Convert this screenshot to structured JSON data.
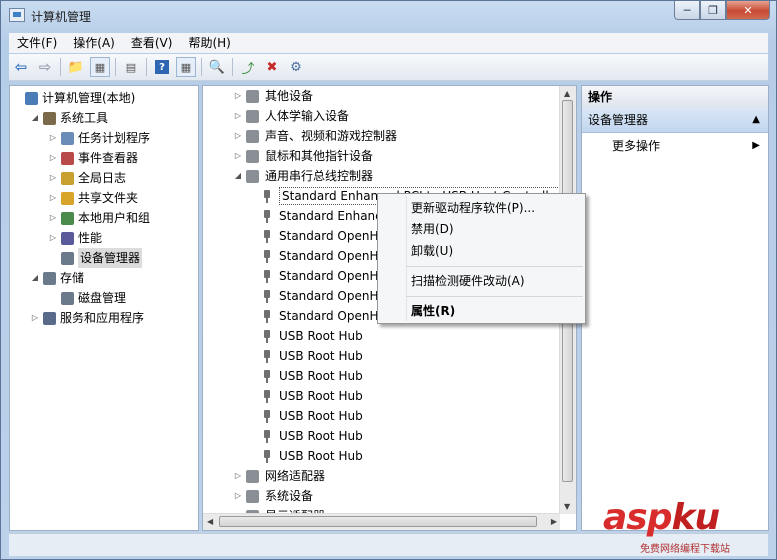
{
  "window": {
    "title": "计算机管理"
  },
  "caption": {
    "minimize": "▭",
    "restore": "▢",
    "close": "✕"
  },
  "menu": [
    "文件(F)",
    "操作(A)",
    "查看(V)",
    "帮助(H)"
  ],
  "left_tree": [
    {
      "label": "计算机管理(本地)",
      "icon": "computer-management-icon",
      "twisty": ""
    },
    {
      "label": "系统工具",
      "icon": "tools-icon",
      "twisty": "◢"
    },
    {
      "label": "任务计划程序",
      "icon": "clock-icon",
      "twisty": "▷"
    },
    {
      "label": "事件查看器",
      "icon": "event-viewer-icon",
      "twisty": "▷"
    },
    {
      "label": "全局日志",
      "icon": "log-icon",
      "twisty": "▷"
    },
    {
      "label": "共享文件夹",
      "icon": "shared-folder-icon",
      "twisty": "▷"
    },
    {
      "label": "本地用户和组",
      "icon": "users-icon",
      "twisty": "▷"
    },
    {
      "label": "性能",
      "icon": "performance-icon",
      "twisty": "▷"
    },
    {
      "label": "设备管理器",
      "icon": "device-manager-icon",
      "twisty": ""
    },
    {
      "label": "存储",
      "icon": "storage-icon",
      "twisty": "◢"
    },
    {
      "label": "磁盘管理",
      "icon": "disk-icon",
      "twisty": ""
    },
    {
      "label": "服务和应用程序",
      "icon": "services-icon",
      "twisty": "▷"
    }
  ],
  "device_tree": [
    {
      "label": "其他设备",
      "twisty": "▷",
      "icon": "other-devices-icon"
    },
    {
      "label": "人体学输入设备",
      "twisty": "▷",
      "icon": "hid-icon"
    },
    {
      "label": "声音、视频和游戏控制器",
      "twisty": "▷",
      "icon": "sound-icon"
    },
    {
      "label": "鼠标和其他指针设备",
      "twisty": "▷",
      "icon": "mouse-icon"
    },
    {
      "label": "通用串行总线控制器",
      "twisty": "◢",
      "icon": "usb-controller-icon"
    },
    {
      "label": "Standard Enhanced PCI to USB Host Controller",
      "twisty": "",
      "icon": "usb"
    },
    {
      "label": "Standard Enhanced PCI to USB Host Controller",
      "twisty": "",
      "icon": "usb"
    },
    {
      "label": "Standard OpenHCD USB Host Controller",
      "twisty": "",
      "icon": "usb"
    },
    {
      "label": "Standard OpenHCD USB Host Controller",
      "twisty": "",
      "icon": "usb"
    },
    {
      "label": "Standard OpenHCD USB Host Controller",
      "twisty": "",
      "icon": "usb"
    },
    {
      "label": "Standard OpenHCD USB Host Controller",
      "twisty": "",
      "icon": "usb"
    },
    {
      "label": "Standard OpenHCD USB Host Controller",
      "twisty": "",
      "icon": "usb"
    },
    {
      "label": "USB Root Hub",
      "twisty": "",
      "icon": "usb"
    },
    {
      "label": "USB Root Hub",
      "twisty": "",
      "icon": "usb"
    },
    {
      "label": "USB Root Hub",
      "twisty": "",
      "icon": "usb"
    },
    {
      "label": "USB Root Hub",
      "twisty": "",
      "icon": "usb"
    },
    {
      "label": "USB Root Hub",
      "twisty": "",
      "icon": "usb"
    },
    {
      "label": "USB Root Hub",
      "twisty": "",
      "icon": "usb"
    },
    {
      "label": "USB Root Hub",
      "twisty": "",
      "icon": "usb"
    },
    {
      "label": "网络适配器",
      "twisty": "▷",
      "icon": "network-adapter-icon"
    },
    {
      "label": "系统设备",
      "twisty": "▷",
      "icon": "system-devices-icon"
    },
    {
      "label": "显示适配器",
      "twisty": "▷",
      "icon": "display-adapter-icon"
    }
  ],
  "context_menu": {
    "items": [
      "更新驱动程序软件(P)...",
      "禁用(D)",
      "卸载(U)",
      "扫描检测硬件改动(A)",
      "属性(R)"
    ]
  },
  "actions": {
    "header": "操作",
    "section": "设备管理器",
    "more": "更多操作"
  },
  "watermark": {
    "main": "asp",
    "mark": "ku",
    "sub": "免费网络编程下载站"
  }
}
